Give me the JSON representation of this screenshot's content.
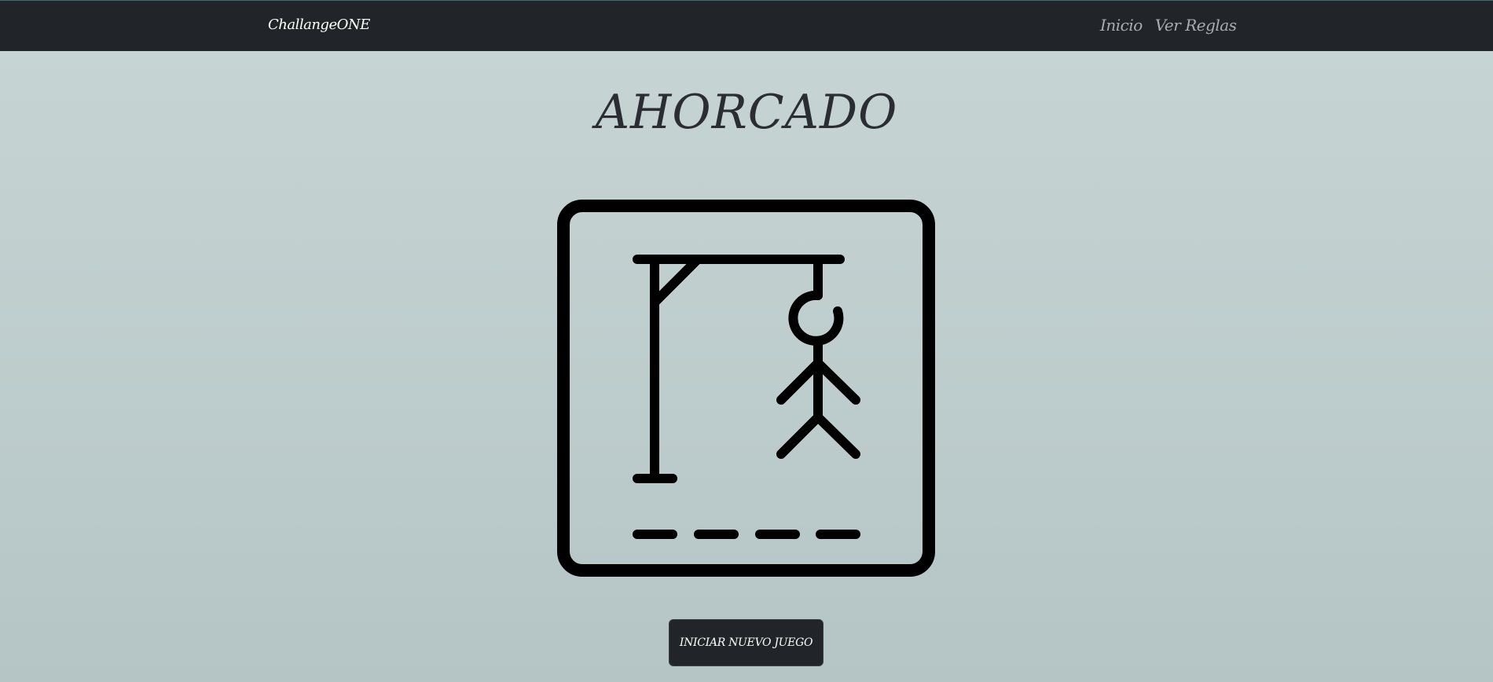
{
  "navbar": {
    "brand": "ChallangeONE",
    "links": [
      {
        "label": "Inicio"
      },
      {
        "label": "Ver Reglas"
      }
    ]
  },
  "main": {
    "title": "AHORCADO",
    "logo_icon": "hangman-icon",
    "start_button_label": "INICIAR NUEVO JUEGO"
  },
  "colors": {
    "navbar_bg": "#212529",
    "page_bg_top": "#c8d5d5",
    "page_bg_bottom": "#b5c5c5",
    "button_bg": "#212529",
    "icon_stroke": "#000000"
  }
}
